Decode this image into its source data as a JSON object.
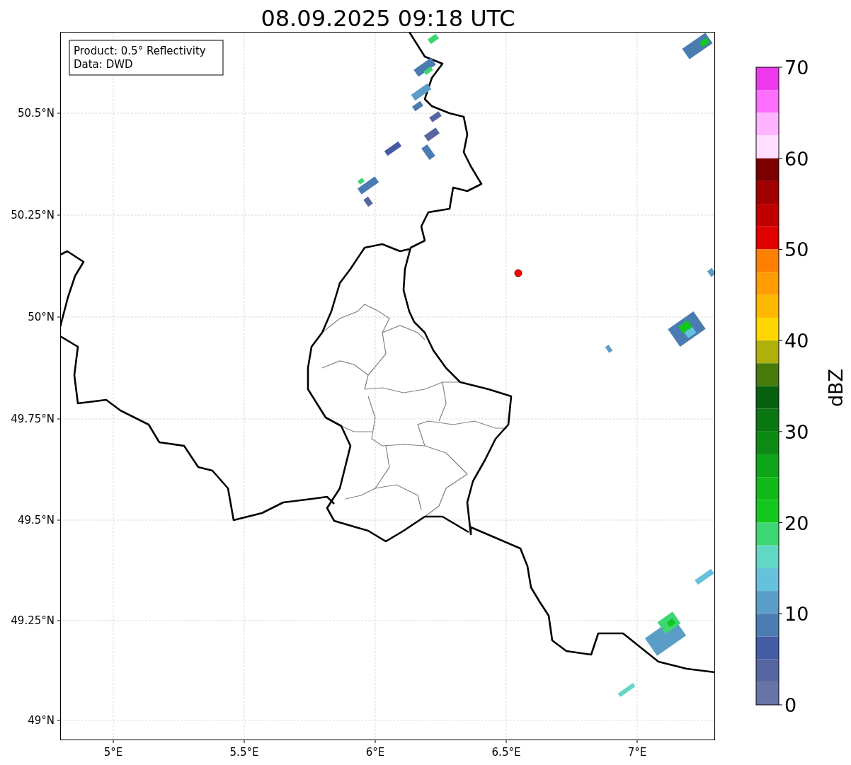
{
  "title": "08.09.2025 09:18 UTC",
  "info_box": {
    "lines": [
      "Product: 0.5° Reflectivity",
      "Data: DWD"
    ]
  },
  "map": {
    "y_ticks": [
      "50.5°N",
      "50.25°N",
      "50°N",
      "49.75°N",
      "49.5°N",
      "49.25°N",
      "49°N"
    ],
    "x_ticks": [
      "5°E",
      "5.5°E",
      "6°E",
      "6.5°E",
      "7°E"
    ]
  },
  "colorbar": {
    "label": "dBZ",
    "ticks": [
      "70",
      "60",
      "50",
      "40",
      "30",
      "20",
      "10",
      "0"
    ],
    "bins": [
      {
        "color": "#ee38ee"
      },
      {
        "color": "#ff6eff"
      },
      {
        "color": "#ffb4ff"
      },
      {
        "color": "#ffdeff"
      },
      {
        "color": "#7c0000"
      },
      {
        "color": "#a00000"
      },
      {
        "color": "#c00000"
      },
      {
        "color": "#e00000"
      },
      {
        "color": "#ff7f00"
      },
      {
        "color": "#ff9c00"
      },
      {
        "color": "#ffb800"
      },
      {
        "color": "#ffd700"
      },
      {
        "color": "#afb00a"
      },
      {
        "color": "#467a0a"
      },
      {
        "color": "#066010"
      },
      {
        "color": "#0a7612"
      },
      {
        "color": "#0c8a14"
      },
      {
        "color": "#0ea418"
      },
      {
        "color": "#10b81a"
      },
      {
        "color": "#12c81f"
      },
      {
        "color": "#3ed672"
      },
      {
        "color": "#62d8c4"
      },
      {
        "color": "#66c2dc"
      },
      {
        "color": "#5a9ec8"
      },
      {
        "color": "#4a7cb2"
      },
      {
        "color": "#445ca3"
      },
      {
        "color": "#5566a0"
      },
      {
        "color": "#6674a6"
      }
    ]
  }
}
